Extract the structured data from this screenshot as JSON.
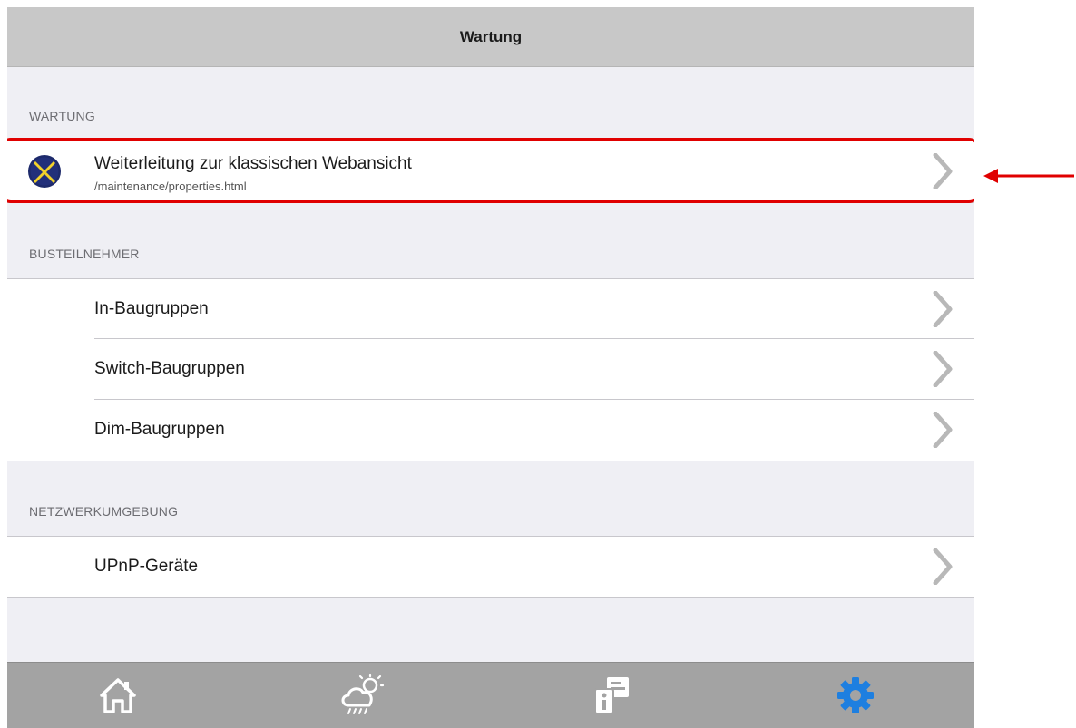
{
  "header": {
    "title": "Wartung"
  },
  "sections": [
    {
      "title": "WARTUNG",
      "items": [
        {
          "label": "Weiterleitung zur klassischen Webansicht",
          "subtitle": "/maintenance/properties.html",
          "icon": "cross-tools-icon"
        }
      ]
    },
    {
      "title": "BUSTEILNEHMER",
      "items": [
        {
          "label": "In-Baugruppen"
        },
        {
          "label": "Switch-Baugruppen"
        },
        {
          "label": "Dim-Baugruppen"
        }
      ]
    },
    {
      "title": "NETZWERKUMGEBUNG",
      "items": [
        {
          "label": "UPnP-Geräte"
        }
      ]
    }
  ],
  "tabbar": {
    "tabs": [
      {
        "icon": "home-icon",
        "active": false
      },
      {
        "icon": "weather-icon",
        "active": false
      },
      {
        "icon": "info-display-icon",
        "active": false
      },
      {
        "icon": "gear-icon",
        "active": true
      }
    ]
  },
  "annotation": {
    "highlight_color": "#e00000",
    "target": "Weiterleitung zur klassischen Webansicht"
  },
  "colors": {
    "active_tab": "#1e7fe0",
    "inactive_tab": "#ffffff",
    "titlebar": "#c8c8c8",
    "tabbar": "#a3a3a3",
    "background": "#efeff4"
  }
}
